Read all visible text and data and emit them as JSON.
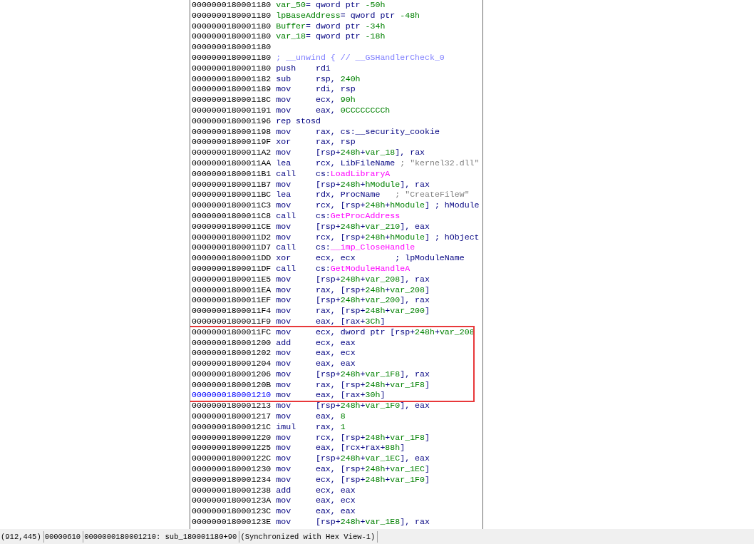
{
  "listing": {
    "blocks": [
      {
        "boxed": false,
        "lines": [
          {
            "address": "0000000180001180",
            "operands": [
              {
                "kind": "name",
                "text": "var_50"
              },
              {
                "kind": "plain",
                "text": "= qword ptr "
              },
              {
                "kind": "name",
                "text": "-50h"
              }
            ],
            "selected": false
          },
          {
            "address": "0000000180001180",
            "operands": [
              {
                "kind": "name",
                "text": "lpBaseAddress"
              },
              {
                "kind": "plain",
                "text": "= qword ptr "
              },
              {
                "kind": "name",
                "text": "-48h"
              }
            ],
            "selected": false
          },
          {
            "address": "0000000180001180",
            "operands": [
              {
                "kind": "name",
                "text": "Buffer"
              },
              {
                "kind": "plain",
                "text": "= dword ptr "
              },
              {
                "kind": "name",
                "text": "-34h"
              }
            ],
            "selected": false
          },
          {
            "address": "0000000180001180",
            "operands": [
              {
                "kind": "name",
                "text": "var_18"
              },
              {
                "kind": "plain",
                "text": "= qword ptr "
              },
              {
                "kind": "name",
                "text": "-18h"
              }
            ],
            "selected": false
          },
          {
            "address": "0000000180001180",
            "selected": false
          },
          {
            "address": "0000000180001180",
            "operands": [
              {
                "kind": "meta",
                "text": "; __unwind { // __GSHandlerCheck_0"
              }
            ],
            "selected": false
          },
          {
            "address": "0000000180001180",
            "mnemonic": "push",
            "operands": [
              {
                "kind": "plain",
                "text": "rdi"
              }
            ],
            "selected": false
          },
          {
            "address": "0000000180001182",
            "mnemonic": "sub",
            "operands": [
              {
                "kind": "plain",
                "text": "rsp, "
              },
              {
                "kind": "name",
                "text": "240h"
              }
            ],
            "selected": false
          },
          {
            "address": "0000000180001189",
            "mnemonic": "mov",
            "operands": [
              {
                "kind": "plain",
                "text": "rdi, rsp"
              }
            ],
            "selected": false
          },
          {
            "address": "000000018000118C",
            "mnemonic": "mov",
            "operands": [
              {
                "kind": "plain",
                "text": "ecx, "
              },
              {
                "kind": "name",
                "text": "90h"
              }
            ],
            "selected": false
          },
          {
            "address": "0000000180001191",
            "mnemonic": "mov",
            "operands": [
              {
                "kind": "plain",
                "text": "eax, "
              },
              {
                "kind": "name",
                "text": "0CCCCCCCCh"
              }
            ],
            "selected": false
          },
          {
            "address": "0000000180001196",
            "mnemonic": "rep stosd",
            "selected": false
          },
          {
            "address": "0000000180001198",
            "mnemonic": "mov",
            "operands": [
              {
                "kind": "plain",
                "text": "rax, cs:__security_cookie"
              }
            ],
            "selected": false
          },
          {
            "address": "000000018000119F",
            "mnemonic": "xor",
            "operands": [
              {
                "kind": "plain",
                "text": "rax, rsp"
              }
            ],
            "selected": false
          },
          {
            "address": "00000001800011A2",
            "mnemonic": "mov",
            "operands": [
              {
                "kind": "plain",
                "text": "[rsp+"
              },
              {
                "kind": "name",
                "text": "248h"
              },
              {
                "kind": "plain",
                "text": "+"
              },
              {
                "kind": "name",
                "text": "var_18"
              },
              {
                "kind": "plain",
                "text": "], rax"
              }
            ],
            "selected": false
          },
          {
            "address": "00000001800011AA",
            "mnemonic": "lea",
            "operands": [
              {
                "kind": "plain",
                "text": "rcx, LibFileName "
              },
              {
                "kind": "comment",
                "text": "; \"kernel32.dll\""
              }
            ],
            "selected": false
          },
          {
            "address": "00000001800011B1",
            "mnemonic": "call",
            "operands": [
              {
                "kind": "plain",
                "text": "cs:"
              },
              {
                "kind": "import",
                "text": "LoadLibraryA"
              }
            ],
            "selected": false
          },
          {
            "address": "00000001800011B7",
            "mnemonic": "mov",
            "operands": [
              {
                "kind": "plain",
                "text": "[rsp+"
              },
              {
                "kind": "name",
                "text": "248h"
              },
              {
                "kind": "plain",
                "text": "+"
              },
              {
                "kind": "name",
                "text": "hModule"
              },
              {
                "kind": "plain",
                "text": "], rax"
              }
            ],
            "selected": false
          },
          {
            "address": "00000001800011BC",
            "mnemonic": "lea",
            "operands": [
              {
                "kind": "plain",
                "text": "rdx, ProcName   "
              },
              {
                "kind": "comment",
                "text": "; \"CreateFileW\""
              }
            ],
            "selected": false
          },
          {
            "address": "00000001800011C3",
            "mnemonic": "mov",
            "operands": [
              {
                "kind": "plain",
                "text": "rcx, [rsp+"
              },
              {
                "kind": "name",
                "text": "248h"
              },
              {
                "kind": "plain",
                "text": "+"
              },
              {
                "kind": "name",
                "text": "hModule"
              },
              {
                "kind": "plain",
                "text": "] ; hModule"
              }
            ],
            "selected": false
          },
          {
            "address": "00000001800011C8",
            "mnemonic": "call",
            "operands": [
              {
                "kind": "plain",
                "text": "cs:"
              },
              {
                "kind": "import",
                "text": "GetProcAddress"
              }
            ],
            "selected": false
          },
          {
            "address": "00000001800011CE",
            "mnemonic": "mov",
            "operands": [
              {
                "kind": "plain",
                "text": "[rsp+"
              },
              {
                "kind": "name",
                "text": "248h"
              },
              {
                "kind": "plain",
                "text": "+"
              },
              {
                "kind": "name",
                "text": "var_210"
              },
              {
                "kind": "plain",
                "text": "], eax"
              }
            ],
            "selected": false
          },
          {
            "address": "00000001800011D2",
            "mnemonic": "mov",
            "operands": [
              {
                "kind": "plain",
                "text": "rcx, [rsp+"
              },
              {
                "kind": "name",
                "text": "248h"
              },
              {
                "kind": "plain",
                "text": "+"
              },
              {
                "kind": "name",
                "text": "hModule"
              },
              {
                "kind": "plain",
                "text": "] ; hObject"
              }
            ],
            "selected": false
          },
          {
            "address": "00000001800011D7",
            "mnemonic": "call",
            "operands": [
              {
                "kind": "plain",
                "text": "cs:"
              },
              {
                "kind": "import",
                "text": "__imp_CloseHandle"
              }
            ],
            "selected": false
          },
          {
            "address": "00000001800011DD",
            "mnemonic": "xor",
            "operands": [
              {
                "kind": "plain",
                "text": "ecx, ecx        ; lpModuleName"
              }
            ],
            "selected": false
          },
          {
            "address": "00000001800011DF",
            "mnemonic": "call",
            "operands": [
              {
                "kind": "plain",
                "text": "cs:"
              },
              {
                "kind": "import",
                "text": "GetModuleHandleA"
              }
            ],
            "selected": false
          },
          {
            "address": "00000001800011E5",
            "mnemonic": "mov",
            "operands": [
              {
                "kind": "plain",
                "text": "[rsp+"
              },
              {
                "kind": "name",
                "text": "248h"
              },
              {
                "kind": "plain",
                "text": "+"
              },
              {
                "kind": "name",
                "text": "var_208"
              },
              {
                "kind": "plain",
                "text": "], rax"
              }
            ],
            "selected": false
          },
          {
            "address": "00000001800011EA",
            "mnemonic": "mov",
            "operands": [
              {
                "kind": "plain",
                "text": "rax, [rsp+"
              },
              {
                "kind": "name",
                "text": "248h"
              },
              {
                "kind": "plain",
                "text": "+"
              },
              {
                "kind": "name",
                "text": "var_208"
              },
              {
                "kind": "plain",
                "text": "]"
              }
            ],
            "selected": false
          },
          {
            "address": "00000001800011EF",
            "mnemonic": "mov",
            "operands": [
              {
                "kind": "plain",
                "text": "[rsp+"
              },
              {
                "kind": "name",
                "text": "248h"
              },
              {
                "kind": "plain",
                "text": "+"
              },
              {
                "kind": "name",
                "text": "var_200"
              },
              {
                "kind": "plain",
                "text": "], rax"
              }
            ],
            "selected": false
          },
          {
            "address": "00000001800011F4",
            "mnemonic": "mov",
            "operands": [
              {
                "kind": "plain",
                "text": "rax, [rsp+"
              },
              {
                "kind": "name",
                "text": "248h"
              },
              {
                "kind": "plain",
                "text": "+"
              },
              {
                "kind": "name",
                "text": "var_200"
              },
              {
                "kind": "plain",
                "text": "]"
              }
            ],
            "selected": false
          },
          {
            "address": "00000001800011F9",
            "mnemonic": "mov",
            "operands": [
              {
                "kind": "plain",
                "text": "eax, [rax+"
              },
              {
                "kind": "name",
                "text": "3Ch"
              },
              {
                "kind": "plain",
                "text": "]"
              }
            ],
            "selected": false
          }
        ]
      },
      {
        "boxed": true,
        "lines": [
          {
            "address": "00000001800011FC",
            "mnemonic": "mov",
            "operands": [
              {
                "kind": "plain",
                "text": "ecx, dword ptr [rsp+"
              },
              {
                "kind": "name",
                "text": "248h"
              },
              {
                "kind": "plain",
                "text": "+"
              },
              {
                "kind": "name",
                "text": "var_208"
              }
            ],
            "selected": false
          },
          {
            "address": "0000000180001200",
            "mnemonic": "add",
            "operands": [
              {
                "kind": "plain",
                "text": "ecx, eax"
              }
            ],
            "selected": false
          },
          {
            "address": "0000000180001202",
            "mnemonic": "mov",
            "operands": [
              {
                "kind": "plain",
                "text": "eax, ecx"
              }
            ],
            "selected": false
          },
          {
            "address": "0000000180001204",
            "mnemonic": "mov",
            "operands": [
              {
                "kind": "plain",
                "text": "eax, eax"
              }
            ],
            "selected": false
          },
          {
            "address": "0000000180001206",
            "mnemonic": "mov",
            "operands": [
              {
                "kind": "plain",
                "text": "[rsp+"
              },
              {
                "kind": "name",
                "text": "248h"
              },
              {
                "kind": "plain",
                "text": "+"
              },
              {
                "kind": "name",
                "text": "var_1F8"
              },
              {
                "kind": "plain",
                "text": "], rax"
              }
            ],
            "selected": false
          },
          {
            "address": "000000018000120B",
            "mnemonic": "mov",
            "operands": [
              {
                "kind": "plain",
                "text": "rax, [rsp+"
              },
              {
                "kind": "name",
                "text": "248h"
              },
              {
                "kind": "plain",
                "text": "+"
              },
              {
                "kind": "name",
                "text": "var_1F8"
              },
              {
                "kind": "plain",
                "text": "]"
              }
            ],
            "selected": false
          },
          {
            "address": "0000000180001210",
            "mnemonic": "mov",
            "operands": [
              {
                "kind": "plain",
                "text": "eax, [rax+"
              },
              {
                "kind": "name",
                "text": "30h"
              },
              {
                "kind": "plain",
                "text": "]"
              }
            ],
            "selected": true
          }
        ]
      },
      {
        "boxed": false,
        "lines": [
          {
            "address": "0000000180001213",
            "mnemonic": "mov",
            "operands": [
              {
                "kind": "plain",
                "text": "[rsp+"
              },
              {
                "kind": "name",
                "text": "248h"
              },
              {
                "kind": "plain",
                "text": "+"
              },
              {
                "kind": "name",
                "text": "var_1F0"
              },
              {
                "kind": "plain",
                "text": "], eax"
              }
            ],
            "selected": false
          },
          {
            "address": "0000000180001217",
            "mnemonic": "mov",
            "operands": [
              {
                "kind": "plain",
                "text": "eax, "
              },
              {
                "kind": "name",
                "text": "8"
              }
            ],
            "selected": false
          },
          {
            "address": "000000018000121C",
            "mnemonic": "imul",
            "operands": [
              {
                "kind": "plain",
                "text": "rax, "
              },
              {
                "kind": "name",
                "text": "1"
              }
            ],
            "selected": false
          },
          {
            "address": "0000000180001220",
            "mnemonic": "mov",
            "operands": [
              {
                "kind": "plain",
                "text": "rcx, [rsp+"
              },
              {
                "kind": "name",
                "text": "248h"
              },
              {
                "kind": "plain",
                "text": "+"
              },
              {
                "kind": "name",
                "text": "var_1F8"
              },
              {
                "kind": "plain",
                "text": "]"
              }
            ],
            "selected": false
          },
          {
            "address": "0000000180001225",
            "mnemonic": "mov",
            "operands": [
              {
                "kind": "plain",
                "text": "eax, [rcx+rax+"
              },
              {
                "kind": "name",
                "text": "88h"
              },
              {
                "kind": "plain",
                "text": "]"
              }
            ],
            "selected": false
          },
          {
            "address": "000000018000122C",
            "mnemonic": "mov",
            "operands": [
              {
                "kind": "plain",
                "text": "[rsp+"
              },
              {
                "kind": "name",
                "text": "248h"
              },
              {
                "kind": "plain",
                "text": "+"
              },
              {
                "kind": "name",
                "text": "var_1EC"
              },
              {
                "kind": "plain",
                "text": "], eax"
              }
            ],
            "selected": false
          },
          {
            "address": "0000000180001230",
            "mnemonic": "mov",
            "operands": [
              {
                "kind": "plain",
                "text": "eax, [rsp+"
              },
              {
                "kind": "name",
                "text": "248h"
              },
              {
                "kind": "plain",
                "text": "+"
              },
              {
                "kind": "name",
                "text": "var_1EC"
              },
              {
                "kind": "plain",
                "text": "]"
              }
            ],
            "selected": false
          },
          {
            "address": "0000000180001234",
            "mnemonic": "mov",
            "operands": [
              {
                "kind": "plain",
                "text": "ecx, [rsp+"
              },
              {
                "kind": "name",
                "text": "248h"
              },
              {
                "kind": "plain",
                "text": "+"
              },
              {
                "kind": "name",
                "text": "var_1F0"
              },
              {
                "kind": "plain",
                "text": "]"
              }
            ],
            "selected": false
          },
          {
            "address": "0000000180001238",
            "mnemonic": "add",
            "operands": [
              {
                "kind": "plain",
                "text": "ecx, eax"
              }
            ],
            "selected": false
          },
          {
            "address": "000000018000123A",
            "mnemonic": "mov",
            "operands": [
              {
                "kind": "plain",
                "text": "eax, ecx"
              }
            ],
            "selected": false
          },
          {
            "address": "000000018000123C",
            "mnemonic": "mov",
            "operands": [
              {
                "kind": "plain",
                "text": "eax, eax"
              }
            ],
            "selected": false
          },
          {
            "address": "000000018000123E",
            "mnemonic": "mov",
            "operands": [
              {
                "kind": "plain",
                "text": "[rsp+"
              },
              {
                "kind": "name",
                "text": "248h"
              },
              {
                "kind": "plain",
                "text": "+"
              },
              {
                "kind": "name",
                "text": "var_1E8"
              },
              {
                "kind": "plain",
                "text": "], rax"
              }
            ],
            "selected": false
          }
        ]
      }
    ]
  },
  "status_bar": {
    "cells": [
      "(912,445)",
      "00000610",
      "0000000180001210: sub_180001180+90",
      "(Synchronized with Hex View-1)"
    ]
  }
}
